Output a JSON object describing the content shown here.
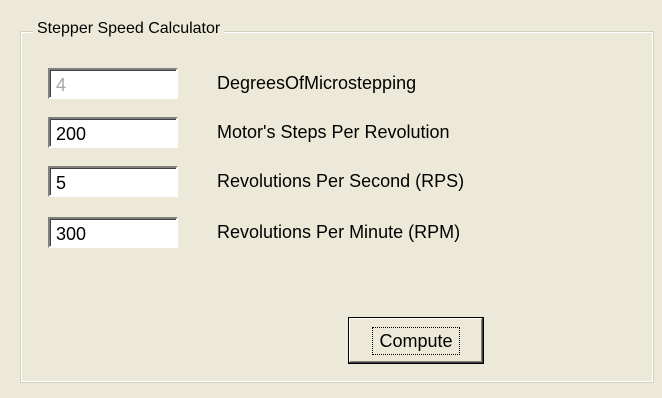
{
  "group": {
    "title": "Stepper Speed Calculator"
  },
  "fields": [
    {
      "value": "4",
      "label": "DegreesOfMicrostepping",
      "enabled": false
    },
    {
      "value": "200",
      "label": "Motor's Steps Per Revolution",
      "enabled": true
    },
    {
      "value": "5",
      "label": "Revolutions Per Second (RPS)",
      "enabled": true
    },
    {
      "value": "300",
      "label": "Revolutions Per Minute (RPM)",
      "enabled": true
    }
  ],
  "buttons": {
    "compute_label": "Compute"
  },
  "colors": {
    "window_background": "#ece9d8",
    "disabled_text": "#a6a6a6"
  }
}
